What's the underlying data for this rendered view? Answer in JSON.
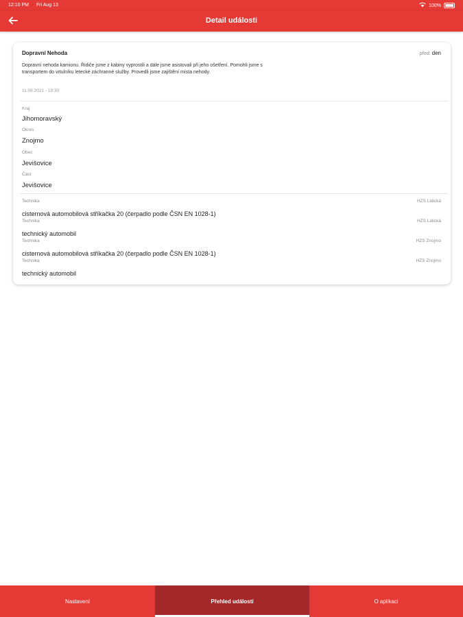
{
  "status_bar": {
    "time": "12:10 PM",
    "date": "Fri Aug 13",
    "battery": "100%",
    "icons": [
      "wifi-icon",
      "battery-icon"
    ]
  },
  "app_bar": {
    "title": "Detail události",
    "back_icon": "arrow-left-icon"
  },
  "event": {
    "title": "Dopravní Nehoda",
    "relative_prefix": "před:",
    "relative_value": "den",
    "description": "Dopravní nehoda kamionu. Řidiče jsme z kabiny vyprostili a dále jsme asistovali při jeho ošetření. Pomohli jsme s transportem do vrtulníku letecké záchranné služby. Provedli jsme zajištění místa nehody.",
    "datetime": "11.08.2021 - 19:30",
    "location": [
      {
        "label": "Kraj",
        "value": "Jihomoravský"
      },
      {
        "label": "Okres",
        "value": "Znojmo"
      },
      {
        "label": "Obec",
        "value": "Jevišovice"
      },
      {
        "label": "Část",
        "value": "Jevišovice"
      }
    ],
    "technika": [
      {
        "label": "Technika",
        "station": "HZS Lidická",
        "vehicle": "cisternová automobilová stříkačka 20 (čerpadlo podle ČSN EN 1028-1)"
      },
      {
        "label": "Technika",
        "station": "HZS Lidická",
        "vehicle": "technický automobil"
      },
      {
        "label": "Technika",
        "station": "HZS Znojmo",
        "vehicle": "cisternová automobilová stříkačka 20 (čerpadlo podle ČSN EN 1028-1)"
      },
      {
        "label": "Technika",
        "station": "HZS Znojmo",
        "vehicle": "technický automobil"
      }
    ]
  },
  "bottom_nav": {
    "tabs": [
      {
        "label": "Nastavení",
        "active": false
      },
      {
        "label": "Přehled událostí",
        "active": true
      },
      {
        "label": "O aplikaci",
        "active": false
      }
    ]
  },
  "colors": {
    "primary": "#e53935",
    "active_tab": "#a4282a",
    "card_bg": "#ffffff"
  }
}
